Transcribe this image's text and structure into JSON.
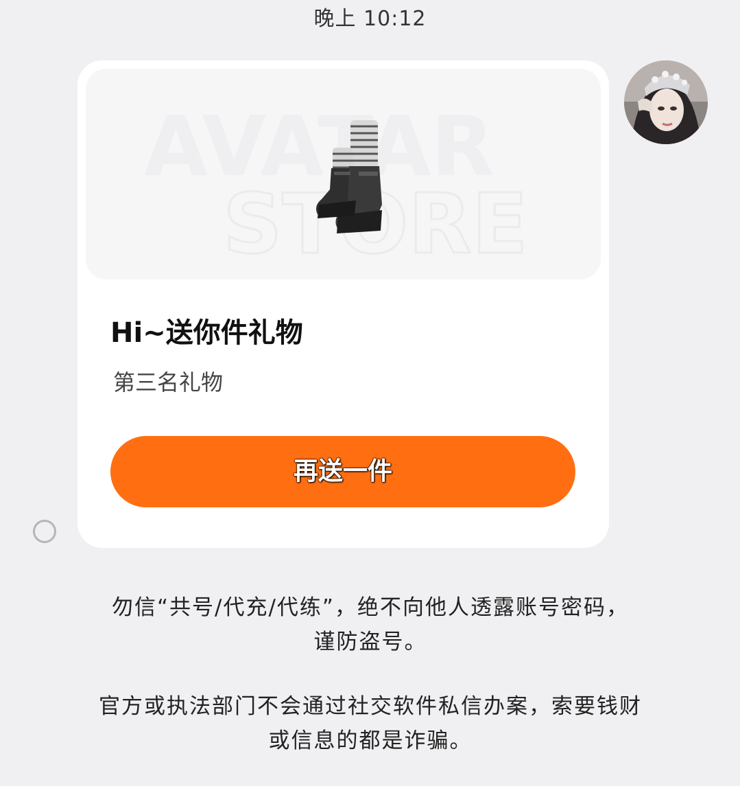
{
  "header": {
    "timestamp": "晚上 10:12"
  },
  "message": {
    "sender_avatar": "user-avatar-photo",
    "gift_card": {
      "store_watermark_line1": "AVATAR",
      "store_watermark_line2": "STORE",
      "item_image": "boots-icon",
      "title": "Hi~送你件礼物",
      "subtitle": "第三名礼物",
      "button_label": "再送一件",
      "button_color": "#ff6f12"
    }
  },
  "system_notices": [
    {
      "line1": "勿信“共号/代充/代练”，绝不向他人透露账号密码，",
      "line2": "谨防盗号。"
    },
    {
      "line1": "官方或执法部门不会通过社交软件私信办案，索要钱财",
      "line2": "或信息的都是诈骗。"
    }
  ]
}
